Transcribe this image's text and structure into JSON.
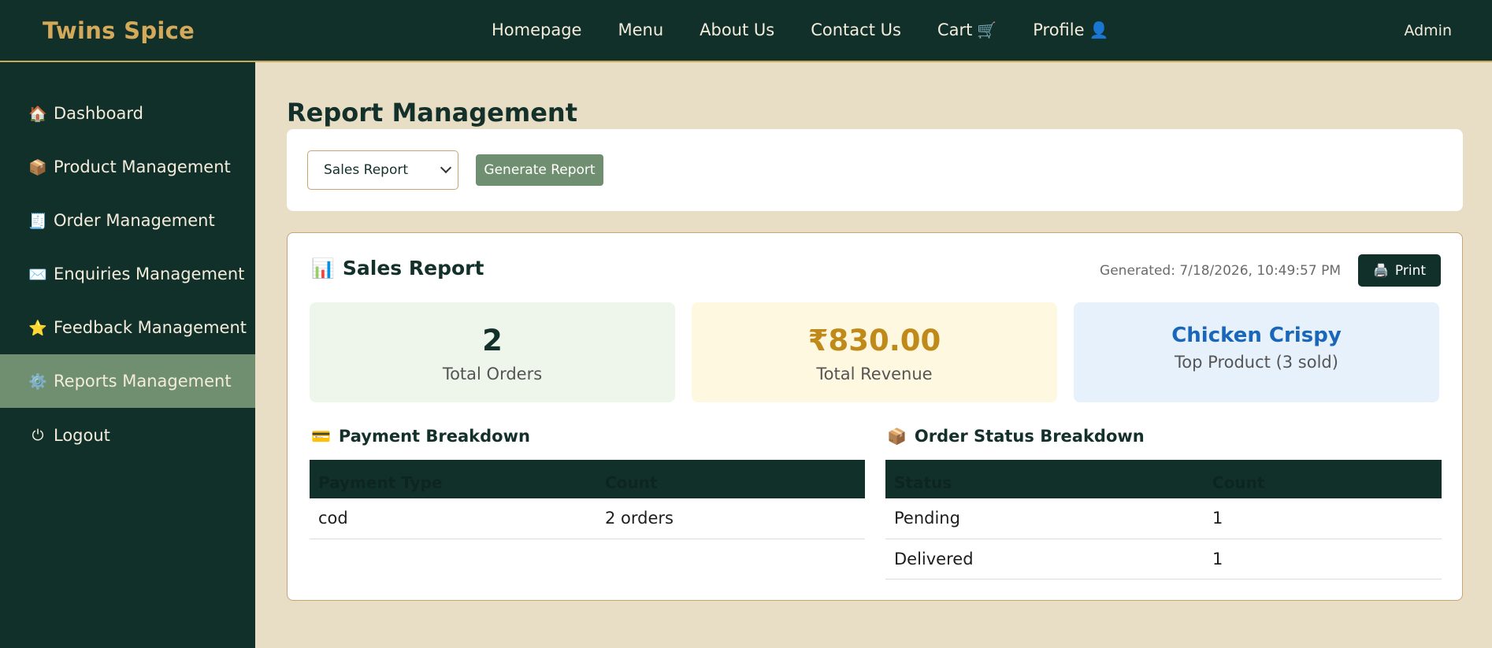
{
  "header": {
    "brand": "Twins Spice",
    "nav": [
      {
        "label": "Homepage"
      },
      {
        "label": "Menu"
      },
      {
        "label": "About Us"
      },
      {
        "label": "Contact Us"
      },
      {
        "label": "Cart",
        "icon": "🛒"
      },
      {
        "label": "Profile",
        "icon": "👤"
      }
    ],
    "user": "Admin"
  },
  "sidebar": {
    "items": [
      {
        "icon": "🏠",
        "label": "Dashboard"
      },
      {
        "icon": "📦",
        "label": "Product Management"
      },
      {
        "icon": "🧾",
        "label": "Order Management"
      },
      {
        "icon": "✉️",
        "label": "Enquiries Management"
      },
      {
        "icon": "⭐",
        "label": "Feedback Management"
      },
      {
        "icon": "⚙️",
        "label": "Reports Management",
        "active": true
      },
      {
        "icon": "⏻",
        "label": "Logout"
      }
    ]
  },
  "main": {
    "title": "Report Management",
    "report_select": {
      "value": "Sales Report"
    },
    "generate_label": "Generate Report",
    "report": {
      "icon": "📊",
      "title": "Sales Report",
      "generated": "Generated: 7/18/2026, 10:49:57 PM",
      "print_icon": "🖨️",
      "print_label": "Print",
      "stats": [
        {
          "value": "2",
          "label": "Total Orders"
        },
        {
          "value": "₹830.00",
          "label": "Total Revenue"
        },
        {
          "value": "Chicken Crispy",
          "label": "Top Product (3 sold)"
        }
      ],
      "payment": {
        "icon": "💳",
        "title": "Payment Breakdown",
        "headers": [
          "Payment Type",
          "Count"
        ],
        "rows": [
          [
            "cod",
            "2 orders"
          ]
        ]
      },
      "order_status": {
        "icon": "📦",
        "title": "Order Status Breakdown",
        "headers": [
          "Status",
          "Count"
        ],
        "rows": [
          [
            "Pending",
            "1"
          ],
          [
            "Delivered",
            "1"
          ]
        ]
      }
    }
  },
  "colors": {
    "dark_green": "#12302a",
    "gold": "#d5a95a",
    "sage": "#6f8f70",
    "beige_bg": "#e8dec6"
  }
}
